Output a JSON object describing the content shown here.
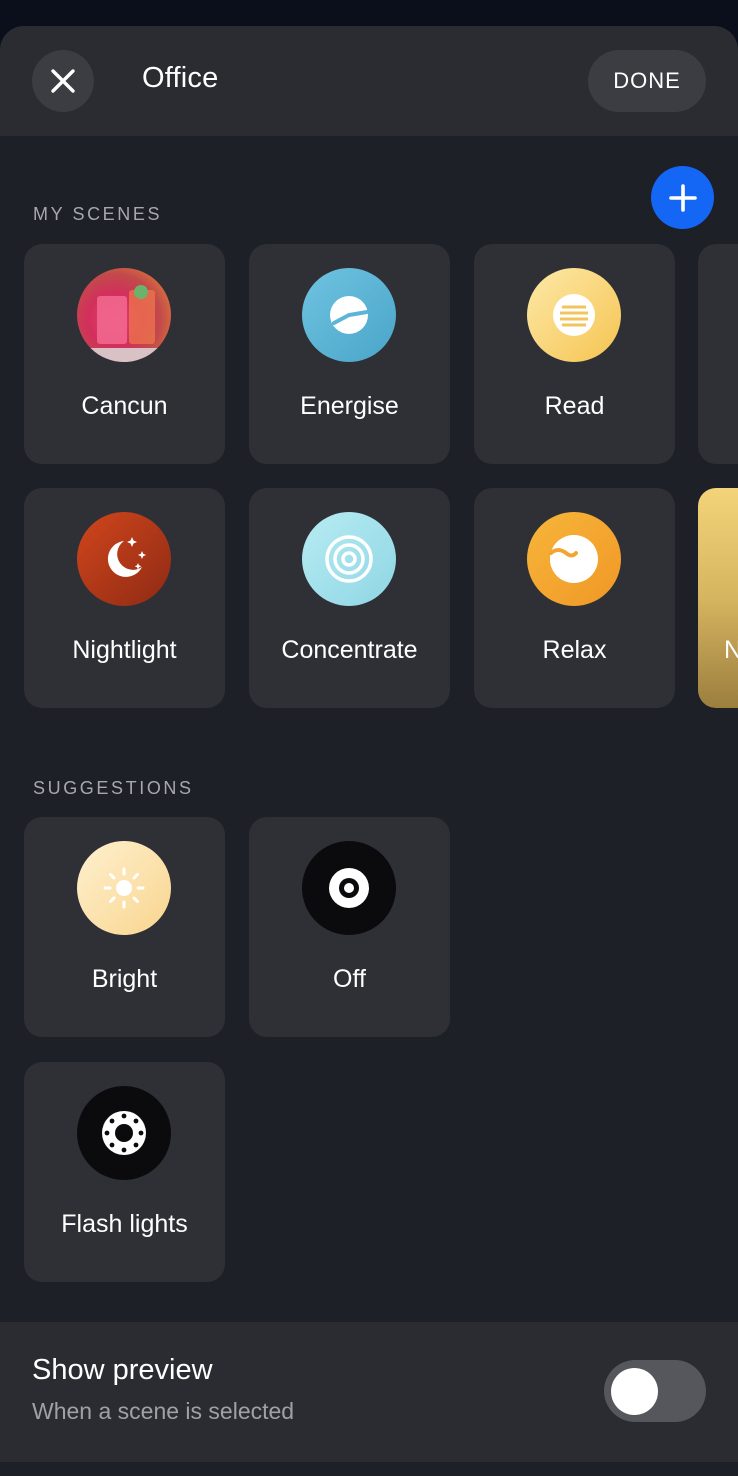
{
  "header": {
    "title": "Office",
    "done_label": "DONE",
    "close_icon": "close-icon"
  },
  "my_scenes": {
    "label": "MY SCENES",
    "add_icon": "plus-icon",
    "items": [
      {
        "label": "Cancun",
        "icon": "cancun-photo-icon"
      },
      {
        "label": "Energise",
        "icon": "energise-icon"
      },
      {
        "label": "Read",
        "icon": "read-icon"
      },
      {
        "label": "Nightlight",
        "icon": "moon-stars-icon"
      },
      {
        "label": "Concentrate",
        "icon": "concentric-rings-icon"
      },
      {
        "label": "Relax",
        "icon": "yin-yang-icon"
      },
      {
        "label": "N"
      }
    ]
  },
  "suggestions": {
    "label": "SUGGESTIONS",
    "items": [
      {
        "label": "Bright",
        "icon": "sun-icon"
      },
      {
        "label": "Off",
        "icon": "off-icon"
      },
      {
        "label": "Flash lights",
        "icon": "flash-lights-icon"
      }
    ]
  },
  "footer": {
    "title": "Show preview",
    "subtitle": "When a scene is selected",
    "toggle_on": false
  },
  "colors": {
    "accent": "#1466f5",
    "background": "#1d2026",
    "tile": "#2e3036"
  }
}
